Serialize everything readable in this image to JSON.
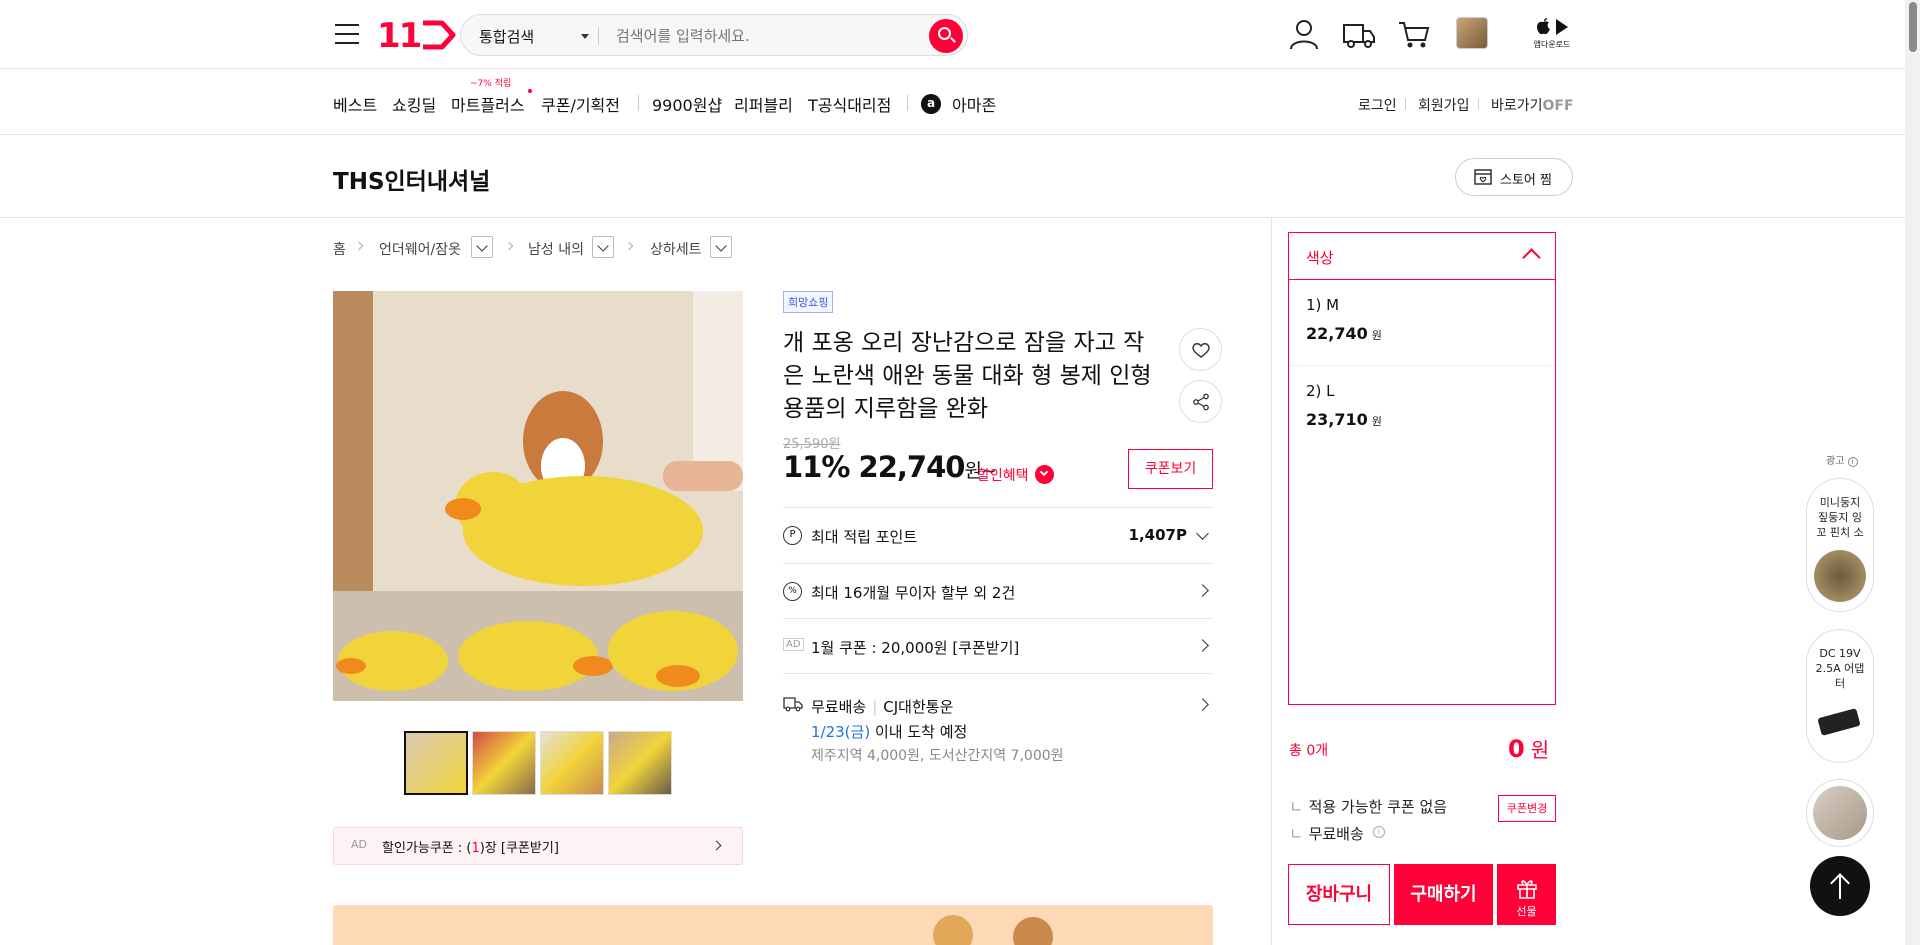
{
  "header": {
    "logo": "11",
    "search_scope": "통합검색",
    "search_placeholder": "검색어를 입력하세요.",
    "app_download": "앱다운로드"
  },
  "gnb": {
    "items": [
      "베스트",
      "쇼킹딜",
      "마트플러스",
      "쿠폰/기획전",
      "9900원샵",
      "리퍼블리",
      "T공식대리점",
      "아마존"
    ],
    "mart_badge": "~7% 적립",
    "login": "로그인",
    "signup": "회원가입",
    "shortcut": "바로가기",
    "shortcut_state": "OFF"
  },
  "store": {
    "name": "THS인터내셔널",
    "zzim": "스토어 찜"
  },
  "breadcrumb": [
    "홈",
    "언더웨어/잠옷",
    "남성 내의",
    "상하세트"
  ],
  "product": {
    "badge": "희망쇼핑",
    "title": "개 포옹 오리 장난감으로 잠을 자고 작은 노란색 애완 동물 대화 형 봉제 인형 용품의 지루함을 완화",
    "original_price": "25,590원",
    "discount": "11%",
    "price": "22,740",
    "price_unit": "원~",
    "benefit": "할인혜택",
    "coupon_view": "쿠폰보기",
    "point_label": "최대 적립 포인트",
    "point_value": "1,407P",
    "installment": "최대 16개월 무이자 할부 외 2건",
    "ad_tag": "AD",
    "coupon_row": "1월 쿠폰 : 20,000원 [쿠폰받기]",
    "shipping_label": "무료배송",
    "shipping_carrier": "CJ대한통운",
    "arrival_date": "1/23(금)",
    "arrival_text": "이내 도착 예정",
    "shipping_extra": "제주지역 4,000원, 도서산간지역 7,000원",
    "ad_coupon_prefix": "할인가능쿠폰 : (",
    "ad_coupon_count": "1",
    "ad_coupon_suffix": ")장 [쿠폰받기]"
  },
  "options": {
    "header": "색상",
    "items": [
      {
        "name": "1) M",
        "price": "22,740",
        "unit": "원"
      },
      {
        "name": "2) L",
        "price": "23,710",
        "unit": "원"
      }
    ]
  },
  "order": {
    "total_label": "총 0개",
    "total_value": "0",
    "total_unit": "원",
    "coupon_none": "적용 가능한 쿠폰 없음",
    "coupon_change": "쿠폰변경",
    "free_shipping": "무료배송",
    "cart": "장바구니",
    "buy": "구매하기",
    "gift": "선물"
  },
  "side_ads": {
    "label": "광고",
    "items": [
      "미니둥지 짚둥지 잉꼬 핀치 소",
      "DC 19V 2.5A 어댑터",
      ""
    ]
  },
  "colors": {
    "accent": "#ff0038",
    "link_blue": "#1a73e8"
  }
}
